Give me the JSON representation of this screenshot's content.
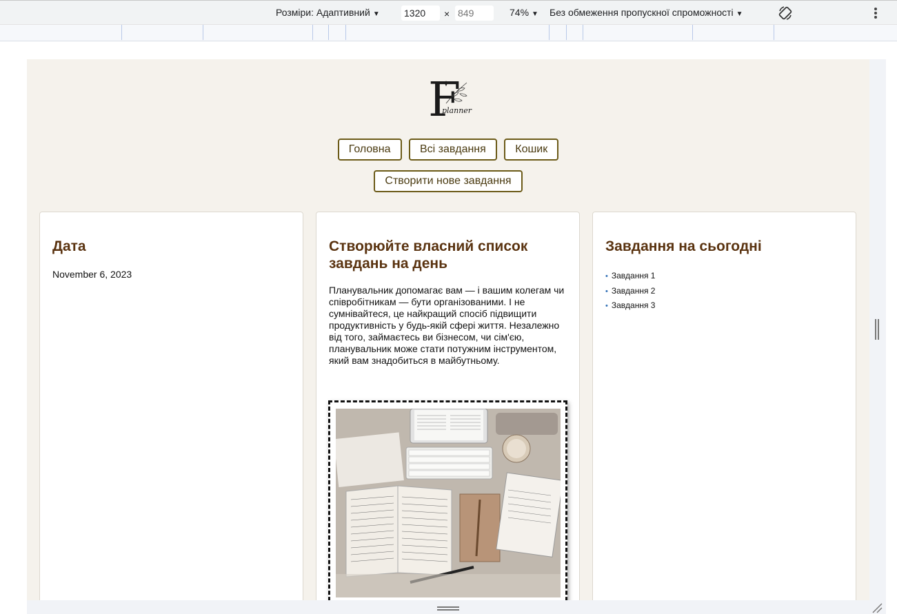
{
  "devtools": {
    "dimensions_label": "Розміри: Адаптивний",
    "width_value": "1320",
    "height_placeholder": "849",
    "times_sign": "×",
    "zoom": "74%",
    "throttling": "Без обмеження пропускної спроможності",
    "rotate_icon": "rotate-icon",
    "menu_icon": "kebab-icon"
  },
  "logo": {
    "letter": "F",
    "word": "planner"
  },
  "nav": {
    "home": "Головна",
    "all_tasks": "Всі завдання",
    "trash": "Кошик",
    "create": "Створити нове завдання"
  },
  "date_card": {
    "title": "Дата",
    "date": "November 6, 2023"
  },
  "info_card": {
    "title": "Створюйте власний список завдань на день",
    "text": "Планувальник допомагає вам — і вашим колегам чи співробітникам — бути організованими. І не сумнівайтеся, це найкращий спосіб підвищити продуктивність у будь-якій сфері життя. Незалежно від того, займаєтесь ви бізнесом, чи сім'єю, планувальник може стати потужним інструментом, який вам знадобиться в майбутньому."
  },
  "today_card": {
    "title": "Завдання на сьогодні",
    "tasks": [
      "Завдання 1",
      "Завдання 2",
      "Завдання 3"
    ]
  },
  "colors": {
    "accent": "#6b5a17",
    "heading": "#5a3310",
    "page_bg": "#f5f2ec"
  }
}
